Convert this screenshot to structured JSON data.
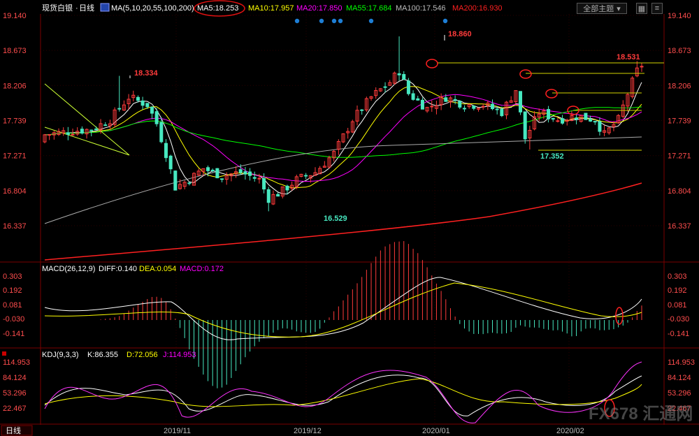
{
  "header": {
    "instrument": "现货白银",
    "period": "日线",
    "ma_spec": "MA(5,10,20,55,100,200)",
    "ma_values": [
      {
        "label": "MA5:18.253",
        "color": "#ffffff"
      },
      {
        "label": "MA10:17.957",
        "color": "#ffff00"
      },
      {
        "label": "MA20:17.850",
        "color": "#ff00ff"
      },
      {
        "label": "MA55:17.684",
        "color": "#00ff00"
      },
      {
        "label": "MA100:17.546",
        "color": "#bbbbbb"
      },
      {
        "label": "MA200:16.930",
        "color": "#ff2020"
      }
    ],
    "main_selector": "全部主题",
    "bottom_left_label": "日线"
  },
  "axes": {
    "price_ticks": [
      "19.140",
      "18.673",
      "18.206",
      "17.739",
      "17.271",
      "16.804",
      "16.337"
    ],
    "macd_ticks": [
      "0.303",
      "0.192",
      "0.081",
      "-0.030",
      "-0.141"
    ],
    "kdj_ticks": [
      "114.953",
      "84.124",
      "53.296",
      "22.467"
    ],
    "date_labels": [
      "2019/11",
      "2019/12",
      "2020/01",
      "2020/02"
    ]
  },
  "macd": {
    "label": "MACD(26,12,9)",
    "diff": "DIFF:0.140",
    "dea": "DEA:0.054",
    "macd": "MACD:0.172"
  },
  "kdj": {
    "label": "KDJ(9,3,3)",
    "k": "K:86.355",
    "d": "D:72.056",
    "j": "J:114.953"
  },
  "annotations": {
    "high_oct": "18.334",
    "low_dec": "16.529",
    "high_jan": "18.860",
    "low_feb": "17.352",
    "last_high": "18.531"
  },
  "watermark": "FX678 汇通网",
  "colors": {
    "up": "#ff3b3b",
    "down": "#47e8c0",
    "axis_text": "#ff4444",
    "grid": "#3a0000"
  },
  "chart_data": {
    "type": "candlestick",
    "series": [
      {
        "name": "MA5",
        "last": 18.253
      },
      {
        "name": "MA10",
        "last": 17.957
      },
      {
        "name": "MA20",
        "last": 17.85
      },
      {
        "name": "MA55",
        "last": 17.684
      },
      {
        "name": "MA100",
        "last": 17.546
      },
      {
        "name": "MA200",
        "last": 16.93
      }
    ],
    "price_range": [
      16.0,
      19.2
    ],
    "indicators": {
      "MACD": {
        "DIFF": 0.14,
        "DEA": 0.054,
        "MACD": 0.172
      },
      "KDJ": {
        "K": 86.355,
        "D": 72.056,
        "J": 114.953
      }
    },
    "marked_levels": [
      18.86,
      18.531,
      18.334,
      17.352,
      16.529
    ]
  }
}
